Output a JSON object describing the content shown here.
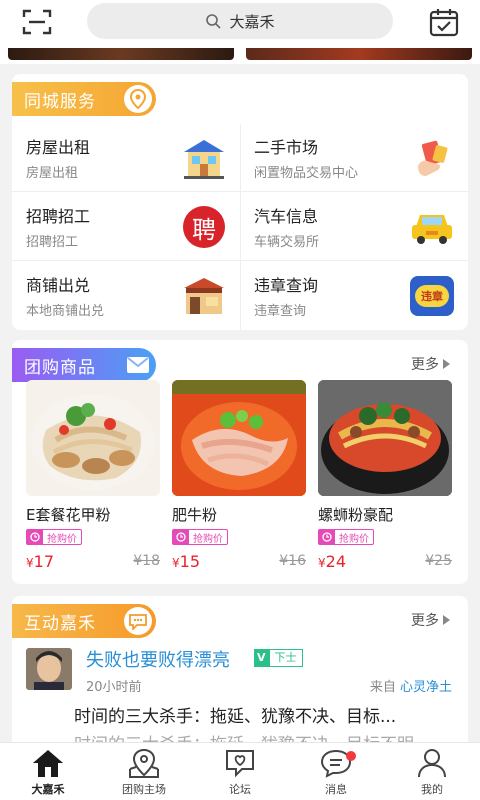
{
  "search": {
    "query": "大嘉禾"
  },
  "services_section": {
    "title": "同城服务",
    "items": [
      {
        "title": "房屋出租",
        "sub": "房屋出租"
      },
      {
        "title": "二手市场",
        "sub": "闲置物品交易中心"
      },
      {
        "title": "招聘招工",
        "sub": "招聘招工",
        "icon_text": "聘"
      },
      {
        "title": "汽车信息",
        "sub": "车辆交易所"
      },
      {
        "title": "商铺出兑",
        "sub": "本地商铺出兑"
      },
      {
        "title": "违章查询",
        "sub": "违章查询",
        "icon_text": "违章"
      }
    ]
  },
  "group_section": {
    "title": "团购商品",
    "more": "更多",
    "tag": "抢购价",
    "currency": "¥",
    "products": [
      {
        "name": "E套餐花甲粉",
        "price": "17",
        "old_price": "¥18"
      },
      {
        "name": "肥牛粉",
        "price": "15",
        "old_price": "¥16"
      },
      {
        "name": "螺蛳粉豪配",
        "price": "24",
        "old_price": "¥25"
      }
    ]
  },
  "interact_section": {
    "title": "互动嘉禾",
    "more": "更多",
    "post": {
      "title": "失败也要败得漂亮",
      "vip": "V",
      "level": "下士",
      "time": "20小时前",
      "from_label": "来自",
      "from_user": "心灵净土",
      "body": "时间的三大杀手：拖延、犹豫不决、目标...",
      "body2": "时间的三大杀手：拖延、犹豫不决、目标不明..."
    }
  },
  "tabs": [
    {
      "label": "大嘉禾",
      "active": true
    },
    {
      "label": "团购主场"
    },
    {
      "label": "论坛"
    },
    {
      "label": "消息",
      "badge": true
    },
    {
      "label": "我的"
    }
  ],
  "colors": {
    "services_pill": "#f5b13a",
    "group_pill": "#a36af2",
    "interact_pill": "#f5a532",
    "price_red": "#e8232e",
    "tag_pink": "#e54ab8",
    "link_blue": "#2a8fd6"
  }
}
